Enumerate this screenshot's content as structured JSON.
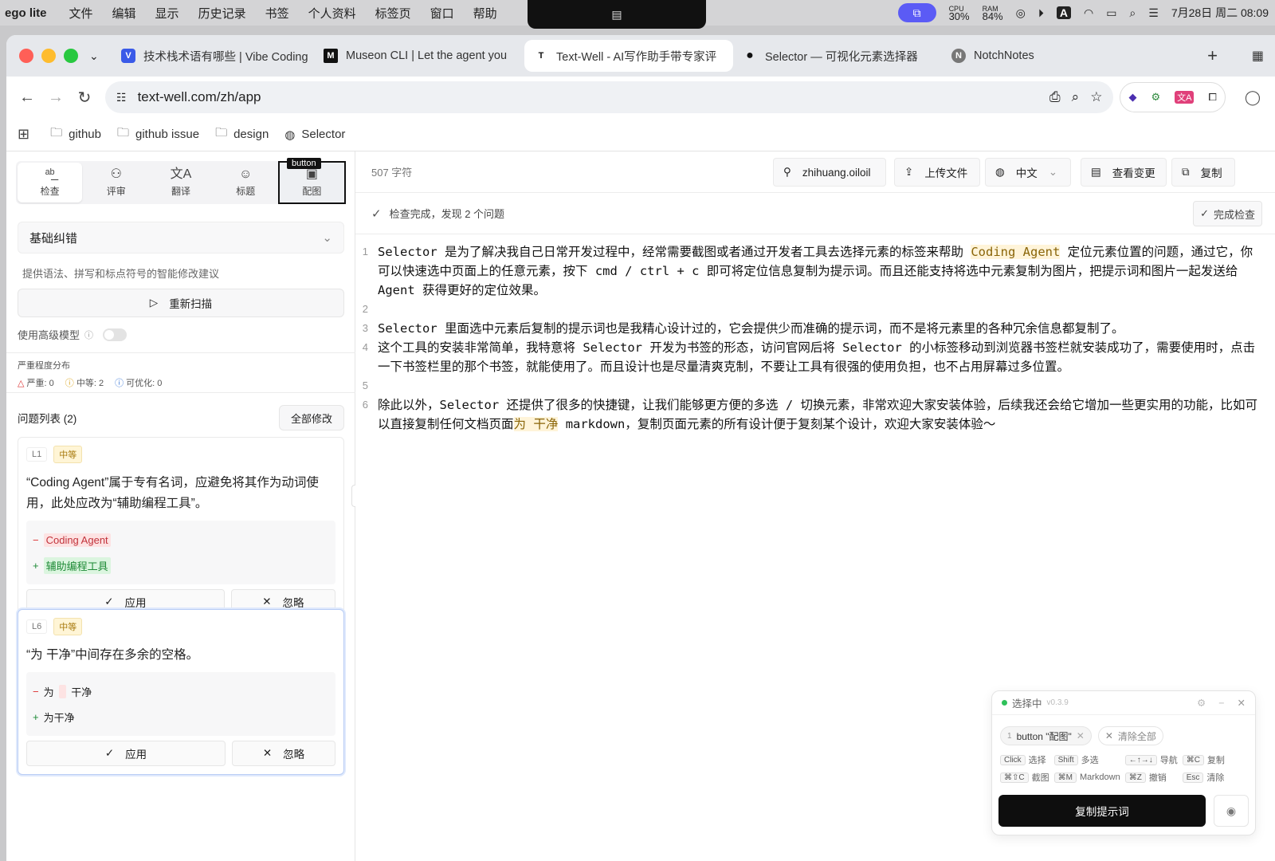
{
  "menubar": {
    "app_name": "ego lite",
    "items": [
      "文件",
      "编辑",
      "显示",
      "历史记录",
      "书签",
      "个人资料",
      "标签页",
      "窗口",
      "帮助"
    ],
    "cpu_label": "CPU",
    "cpu_value": "30%",
    "ram_label": "RAM",
    "ram_value": "84%",
    "keyboard_input": "A",
    "datetime": "7月28日 周二  08:09"
  },
  "browser": {
    "tabs": [
      {
        "title": "技术栈术语有哪些 | Vibe Coding",
        "favicon": "V"
      },
      {
        "title": "Museon CLI | Let the agent you",
        "favicon": "M"
      },
      {
        "title": "Text-Well - AI写作助手带专家评",
        "favicon": "T"
      },
      {
        "title": "Selector — 可视化元素选择器",
        "favicon": "●"
      },
      {
        "title": "NotchNotes",
        "favicon": "N"
      }
    ],
    "url": "text-well.com/zh/app",
    "bookmarks": [
      "github",
      "github issue",
      "design",
      "Selector"
    ]
  },
  "left": {
    "modes": [
      "检查",
      "评审",
      "翻译",
      "标题",
      "配图"
    ],
    "selected_tag": "button",
    "category": "基础纠错",
    "category_desc": "提供语法、拼写和标点符号的智能修改建议",
    "rescan_label": "重新扫描",
    "advanced_label": "使用高级模型",
    "severity_title": "严重程度分布",
    "severity": {
      "severe": "严重: 0",
      "medium": "中等: 2",
      "optimizable": "可优化: 0"
    },
    "issues_title": "问题列表 (2)",
    "fix_all": "全部修改",
    "issues": [
      {
        "line": "L1",
        "level": "中等",
        "message": "“Coding Agent”属于专有名词，应避免将其作为动词使用，此处应改为“辅助编程工具”。",
        "removed": "Coding Agent",
        "added": "辅助编程工具",
        "apply": "应用",
        "ignore": "忽略"
      },
      {
        "line": "L6",
        "level": "中等",
        "message": "“为 干净”中间存在多余的空格。",
        "removed_a": "为",
        "removed_b": "干净",
        "added": "为干净",
        "apply": "应用",
        "ignore": "忽略"
      }
    ]
  },
  "right": {
    "char_count": "507 字符",
    "user": "zhihuang.oiloil",
    "upload": "上传文件",
    "language": "中文",
    "view_changes": "查看变更",
    "copy": "复制",
    "check_status": "检查完成，发现 2 个问题",
    "finish_check": "完成检查",
    "lines": {
      "l1_a": "Selector 是为了解决我自己日常开发过程中，经常需要截图或者通过开发者工具去选择元素的标签来帮助 ",
      "l1_hl": "Coding Agent",
      "l1_b": " 定位元素位置的问题，通过它，你可以快速选中页面上的任意元素，按下 cmd / ctrl + c 即可将定位信息复制为提示词。而且还能支持将选中元素复制为图片，把提示词和图片一起发送给 Agent 获得更好的定位效果。",
      "l3": "Selector 里面选中元素后复制的提示词也是我精心设计过的，它会提供少而准确的提示词，而不是将元素里的各种冗余信息都复制了。",
      "l4": "这个工具的安装非常简单，我特意将 Selector 开发为书签的形态，访问官网后将 Selector 的小标签移动到浏览器书签栏就安装成功了，需要使用时，点击一下书签栏里的那个书签，就能使用了。而且设计也是尽量清爽克制，不要让工具有很强的使用负担，也不占用屏幕过多位置。",
      "l6_a": "除此以外，Selector 还提供了很多的快捷键，让我们能够更方便的多选 / 切换元素，非常欢迎大家安装体验，后续我还会给它增加一些更实用的功能，比如可以直接复制任何文档页面",
      "l6_hl": "为 干净",
      "l6_b": " markdown，复制页面元素的所有设计便于复刻某个设计，欢迎大家安装体验～"
    }
  },
  "selector_panel": {
    "status": "选择中",
    "version": "v0.3.9",
    "chip_index": "1",
    "chip_label": "button \"配图\"",
    "clear_all": "清除全部",
    "keys": [
      {
        "k": "Click",
        "d": "选择"
      },
      {
        "k": "Shift",
        "d": "多选"
      },
      {
        "k": "←↑→↓",
        "d": "导航"
      },
      {
        "k": "⌘C",
        "d": "复制"
      },
      {
        "k": "⌘⇧C",
        "d": "截图"
      },
      {
        "k": "⌘M",
        "d": "Markdown"
      },
      {
        "k": "⌘Z",
        "d": "撤销"
      },
      {
        "k": "Esc",
        "d": "清除"
      }
    ],
    "copy_prompt": "复制提示词"
  },
  "colors": {
    "accent": "#5b5bf5",
    "medium_badge": "#fff5d6",
    "del_bg": "#fde3e3",
    "ins_bg": "#dbf5df"
  }
}
